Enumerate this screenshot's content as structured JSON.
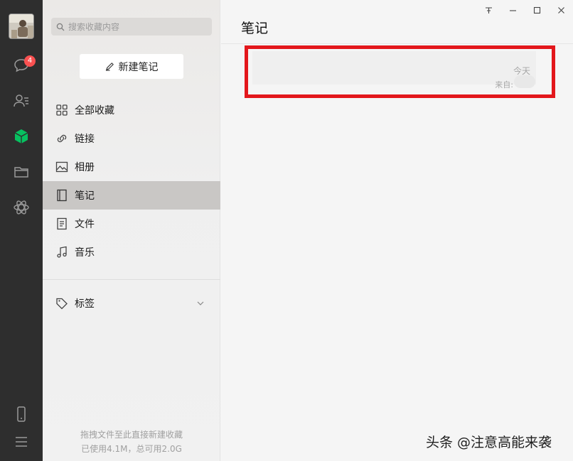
{
  "rail": {
    "badge_count": "4",
    "active_color": "#07c160"
  },
  "sidebar": {
    "search_placeholder": "搜索收藏内容",
    "new_note_label": "新建笔记",
    "items": [
      {
        "label": "全部收藏",
        "icon": "grid-icon"
      },
      {
        "label": "链接",
        "icon": "link-icon"
      },
      {
        "label": "相册",
        "icon": "image-icon"
      },
      {
        "label": "笔记",
        "icon": "notebook-icon",
        "active": true
      },
      {
        "label": "文件",
        "icon": "file-icon"
      },
      {
        "label": "音乐",
        "icon": "music-icon"
      }
    ],
    "tags_label": "标签",
    "footer_line1": "拖拽文件至此直接新建收藏",
    "footer_line2": "已使用4.1M，总可用2.0G"
  },
  "main": {
    "title": "笔记",
    "note": {
      "date": "今天",
      "source_label": "来自:"
    },
    "highlight_color": "#e3171c"
  },
  "watermark": "头条 @注意高能来袭"
}
